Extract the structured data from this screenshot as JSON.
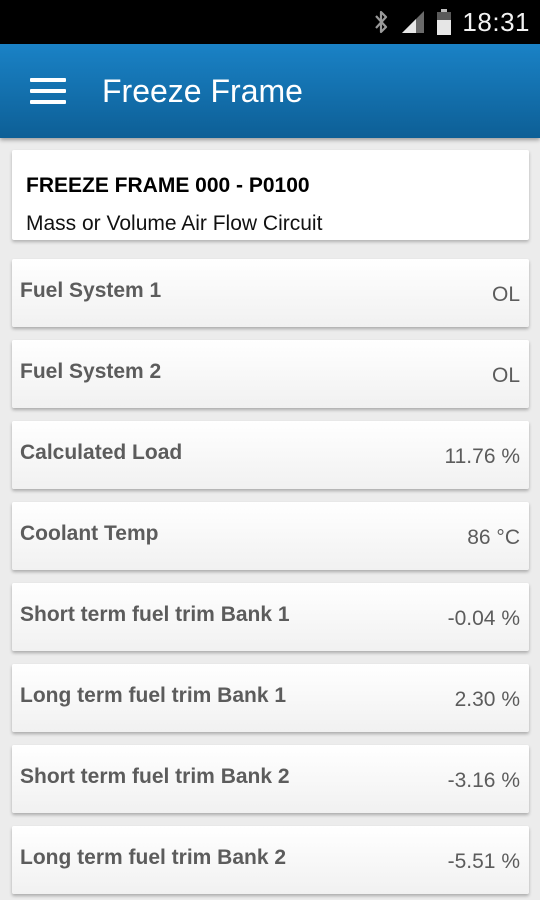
{
  "status_bar": {
    "time": "18:31",
    "icons": [
      "bluetooth-icon",
      "signal-icon",
      "battery-icon"
    ]
  },
  "app_bar": {
    "title": "Freeze Frame",
    "menu_icon": "hamburger-menu-icon",
    "color": "#1577b5"
  },
  "freeze_frame": {
    "title": "FREEZE FRAME 000 - P0100",
    "description": "Mass or Volume Air Flow Circuit"
  },
  "parameters": [
    {
      "label": "Fuel System 1",
      "value": "OL"
    },
    {
      "label": "Fuel System 2",
      "value": "OL"
    },
    {
      "label": "Calculated Load",
      "value": "11.76 %"
    },
    {
      "label": "Coolant Temp",
      "value": "86 °C"
    },
    {
      "label": "Short term fuel trim Bank 1",
      "value": "-0.04 %"
    },
    {
      "label": "Long term fuel trim Bank 1",
      "value": "2.30 %"
    },
    {
      "label": "Short term fuel trim Bank 2",
      "value": "-3.16 %"
    },
    {
      "label": "Long term fuel trim Bank 2",
      "value": "-5.51 %"
    }
  ]
}
